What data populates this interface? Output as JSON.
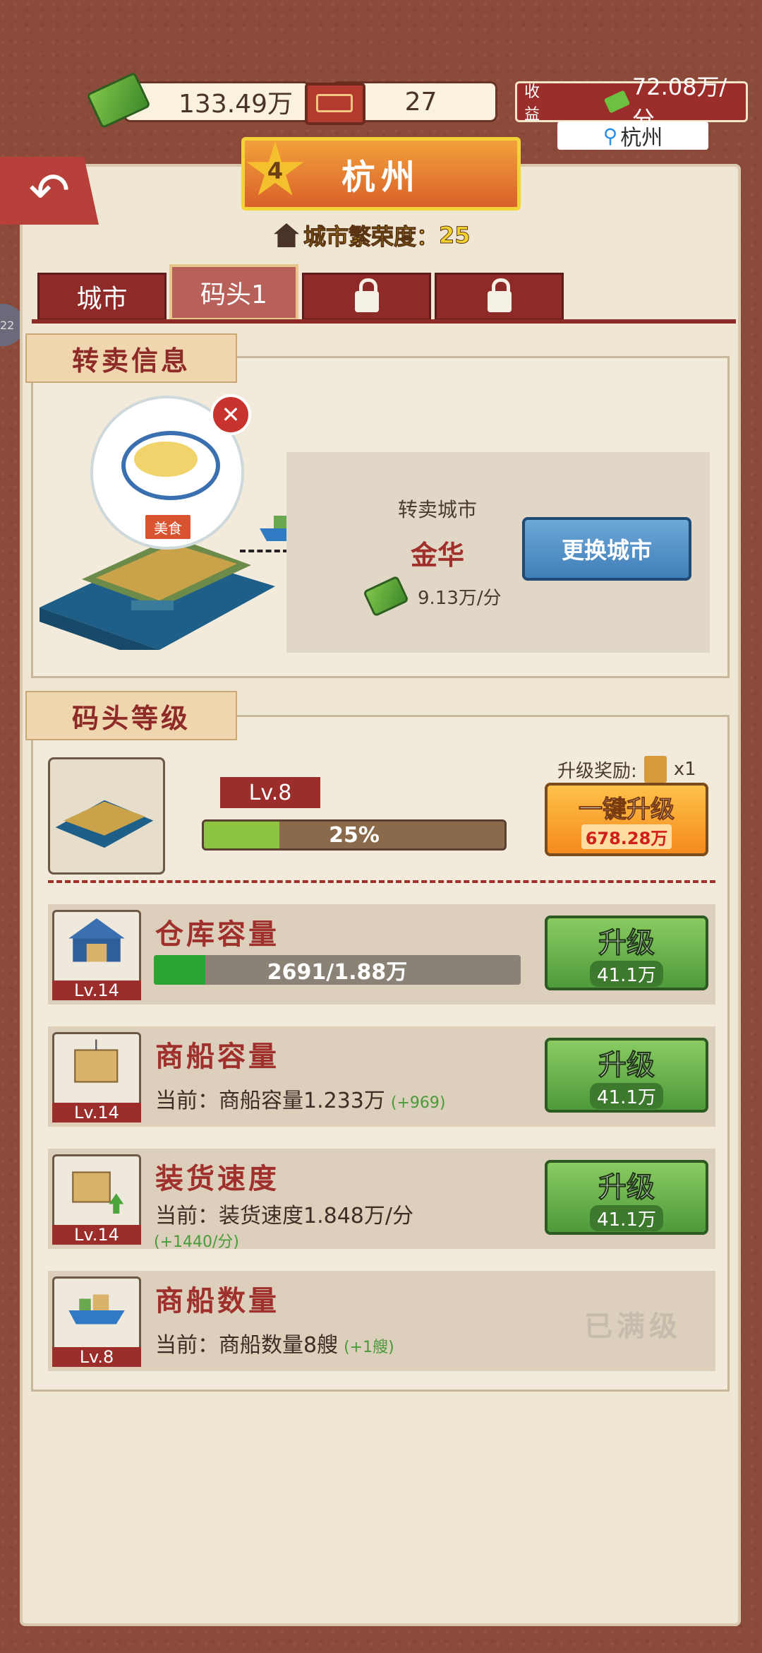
{
  "topbar": {
    "money": "133.49万",
    "tickets": "27",
    "income_label": "收益",
    "income_value": "72.08万/分",
    "location": "杭州"
  },
  "city": {
    "star_level": "4",
    "name": "杭州",
    "prosperity_label": "城市繁荣度：",
    "prosperity_value": "25"
  },
  "tabs": [
    {
      "label": "城市",
      "active": false,
      "locked": false
    },
    {
      "label": "码头1",
      "active": true,
      "locked": false
    },
    {
      "label": "",
      "active": false,
      "locked": true
    },
    {
      "label": "",
      "active": false,
      "locked": true
    }
  ],
  "resale": {
    "section_title": "转卖信息",
    "goods_tag": "美食",
    "target_label": "转卖城市",
    "target_city": "金华",
    "rate": "9.13万/分",
    "change_button": "更换城市"
  },
  "dock_level": {
    "section_title": "码头等级",
    "level": "Lv.8",
    "progress_text": "25%",
    "progress": 0.25,
    "reward_label": "升级奖励:",
    "reward_count": "x1",
    "oneclick_label": "一键升级",
    "oneclick_cost": "678.28万"
  },
  "upgrades": [
    {
      "title": "仓库容量",
      "level": "Lv.14",
      "bar_text": "2691/1.88万",
      "bar_progress": 0.14,
      "button": "升级",
      "cost": "41.1万"
    },
    {
      "title": "商船容量",
      "level": "Lv.14",
      "desc": "当前：商船容量1.233万",
      "plus": "(+969)",
      "button": "升级",
      "cost": "41.1万"
    },
    {
      "title": "装货速度",
      "level": "Lv.14",
      "desc": "当前：装货速度1.848万/分",
      "extra": "(+1440/分)",
      "button": "升级",
      "cost": "41.1万"
    },
    {
      "title": "商船数量",
      "level": "Lv.8",
      "desc": "当前：商船数量8艘",
      "plus": "(+1艘)",
      "maxed": "已满级"
    }
  ],
  "colors": {
    "accent_red": "#9b2d2a",
    "gold": "#f4d22e",
    "green_button": "#4e9a3a",
    "orange_button": "#f48a1e",
    "blue_button": "#3f7eb8"
  }
}
